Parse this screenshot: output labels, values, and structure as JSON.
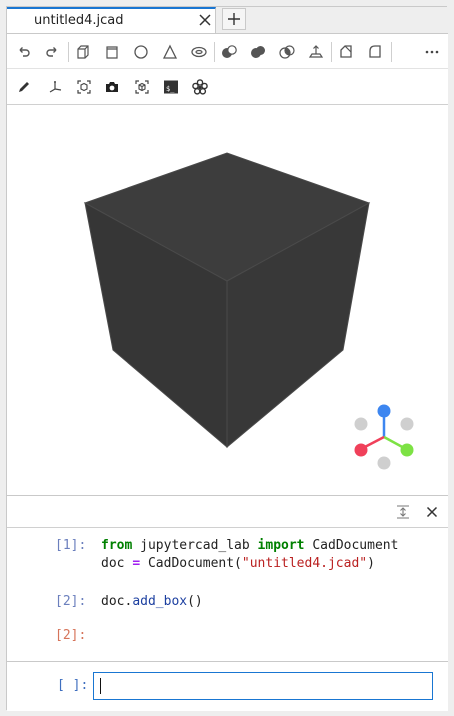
{
  "tab": {
    "title": "untitled4.jcad"
  },
  "toolbar1": {
    "items": [
      {
        "name": "undo-button",
        "icon": "undo-icon"
      },
      {
        "name": "redo-button",
        "icon": "redo-icon"
      },
      {
        "name": "add-box-button",
        "icon": "box-icon"
      },
      {
        "name": "add-cylinder-button",
        "icon": "cylinder-icon"
      },
      {
        "name": "add-sphere-button",
        "icon": "sphere-icon"
      },
      {
        "name": "add-cone-button",
        "icon": "cone-icon"
      },
      {
        "name": "add-torus-button",
        "icon": "torus-icon"
      },
      {
        "name": "cut-button",
        "icon": "cut-icon"
      },
      {
        "name": "union-button",
        "icon": "union-icon"
      },
      {
        "name": "intersection-button",
        "icon": "intersection-icon"
      },
      {
        "name": "extrusion-button",
        "icon": "extrusion-icon"
      },
      {
        "name": "chamfer-button",
        "icon": "chamfer-icon"
      },
      {
        "name": "fillet-button",
        "icon": "fillet-icon"
      },
      {
        "name": "more-button",
        "icon": "more-icon"
      }
    ]
  },
  "toolbar2": {
    "items": [
      {
        "name": "sketch-button",
        "icon": "pencil-icon"
      },
      {
        "name": "axes-button",
        "icon": "axes-icon"
      },
      {
        "name": "explode-button",
        "icon": "explode-icon"
      },
      {
        "name": "screenshot-button",
        "icon": "camera-icon"
      },
      {
        "name": "camera-view-button",
        "icon": "view-cube-icon"
      },
      {
        "name": "console-button",
        "icon": "terminal-icon"
      },
      {
        "name": "suggestion-button",
        "icon": "flower-icon"
      }
    ]
  },
  "viewer": {
    "model_color": "#3b3b3b",
    "axes": {
      "x_color": "#7de244",
      "y_color": "#3d86f0",
      "z_color": "#f0405a"
    }
  },
  "console": {
    "cells": [
      {
        "prompt": "[1]:",
        "lines": [
          "from jupytercad_lab import CadDocument",
          "doc = CadDocument(\"untitled4.jcad\")"
        ]
      },
      {
        "prompt": "[2]:",
        "lines": [
          "doc.add_box()"
        ]
      },
      {
        "prompt": "[2]:",
        "lines": []
      }
    ],
    "input_prompt": "[ ]:",
    "input_value": ""
  },
  "colors": {
    "accent": "#1976d2"
  }
}
